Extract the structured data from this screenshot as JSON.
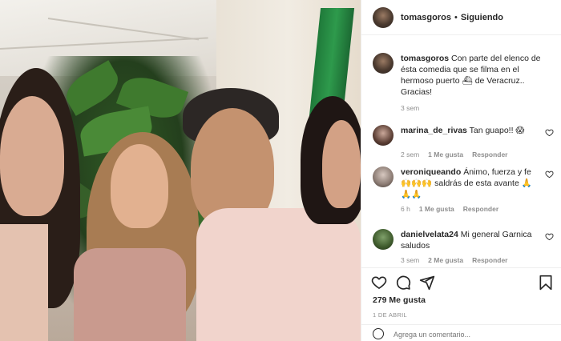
{
  "post": {
    "username": "tomasgoros",
    "follow_separator": "•",
    "follow_label": "Siguiendo",
    "caption_text": "Con parte del elenco de ésta comedia que se filma en el hermoso puerto ⛴ de Veracruz.. Gracias!",
    "caption_time": "3 sem"
  },
  "comments": [
    {
      "username": "marina_de_rivas",
      "text": "Tan guapo!! 😱",
      "time": "2 sem",
      "likes": "1 Me gusta",
      "reply": "Responder"
    },
    {
      "username": "veroniqueando",
      "text": "Ánimo, fuerza y fe 🙌🙌🙌 saldrás de esta avante 🙏🙏🙏",
      "time": "6 h",
      "likes": "1 Me gusta",
      "reply": "Responder"
    },
    {
      "username": "danielvelata24",
      "text": "Mi general Garnica saludos",
      "time": "3 sem",
      "likes": "2 Me gusta",
      "reply": "Responder"
    }
  ],
  "footer": {
    "likes_count": "279 Me gusta",
    "date": "1 DE ABRIL",
    "add_comment_placeholder": "Agrega un comentario..."
  },
  "icons": {
    "like": "heart-icon",
    "comment": "comment-icon",
    "share": "share-icon",
    "save": "bookmark-icon",
    "comment_like": "heart-icon"
  },
  "colors": {
    "text": "#262626",
    "muted": "#8e8e8e",
    "border": "#efefef"
  }
}
